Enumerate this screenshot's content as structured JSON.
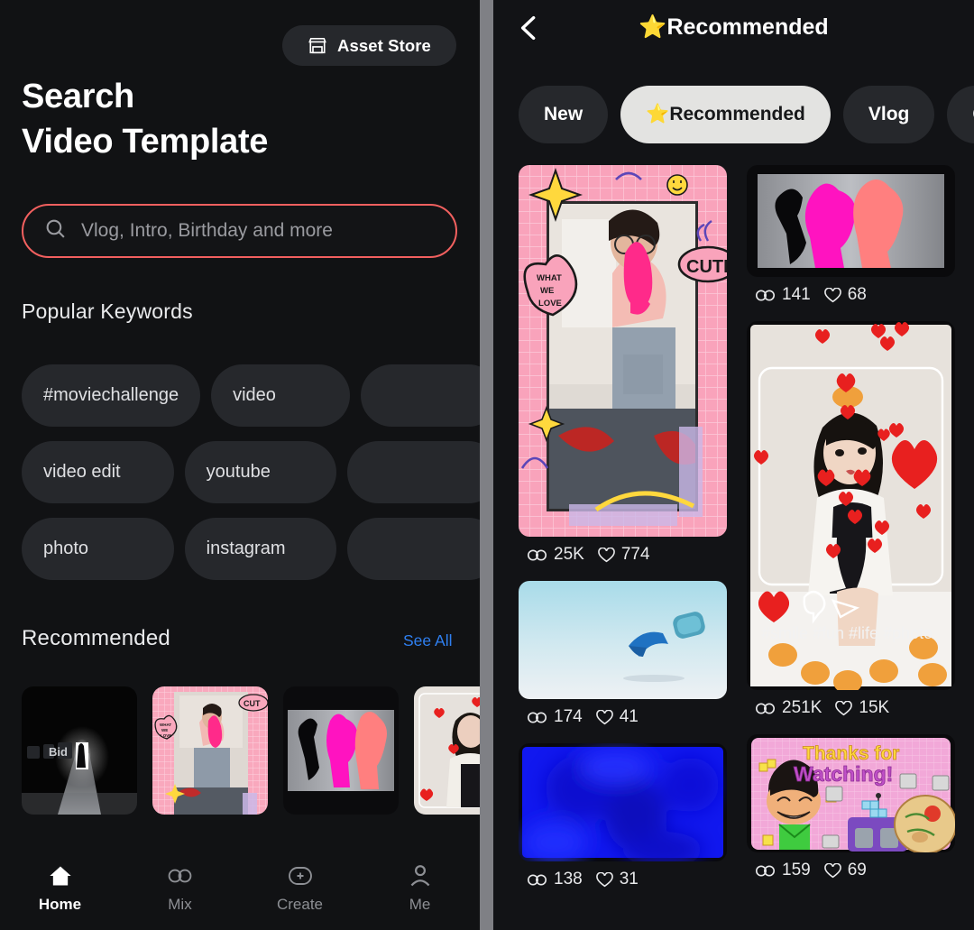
{
  "left": {
    "asset_store": {
      "label": "Asset Store",
      "icon": "store-icon"
    },
    "title_line1": "Search",
    "title_line2": "Video Template",
    "search": {
      "placeholder": "Vlog, Intro, Birthday and more",
      "icon": "search-icon",
      "border_color": "#f2605f"
    },
    "keywords_heading": "Popular Keywords",
    "keywords": [
      [
        "#moviechallenge",
        "video",
        ""
      ],
      [
        "video edit",
        "youtube",
        ""
      ],
      [
        "photo",
        "instagram",
        ""
      ]
    ],
    "recommended_heading": "Recommended",
    "see_all": "See All",
    "recommended_thumbs": [
      {
        "name": "dark-hallway-template"
      },
      {
        "name": "pink-scrapbook-template"
      },
      {
        "name": "neon-silhouette-template"
      },
      {
        "name": "hearts-girl-template"
      }
    ],
    "nav": [
      {
        "label": "Home",
        "icon": "home-icon",
        "active": true
      },
      {
        "label": "Mix",
        "icon": "mix-icon",
        "active": false
      },
      {
        "label": "Create",
        "icon": "plus-circle-icon",
        "active": false
      },
      {
        "label": "Me",
        "icon": "person-icon",
        "active": false
      }
    ]
  },
  "right": {
    "back_icon": "chevron-left-icon",
    "title": "⭐Recommended",
    "tabs": [
      {
        "label": "New",
        "active": false
      },
      {
        "label": "⭐Recommended",
        "active": true
      },
      {
        "label": "Vlog",
        "active": false
      },
      {
        "label": "G",
        "active": false
      }
    ],
    "cards": {
      "left_col": [
        {
          "name": "pink-scrapbook-card",
          "plays": "25K",
          "likes": "774"
        },
        {
          "name": "blue-sky-card",
          "plays": "174",
          "likes": "41"
        },
        {
          "name": "blue-abstract-card",
          "plays": "138",
          "likes": "31"
        }
      ],
      "right_col": [
        {
          "name": "neon-silhouette-card",
          "plays": "141",
          "likes": "68"
        },
        {
          "name": "hearts-girl-card",
          "plays": "251K",
          "likes": "15K",
          "hashtags": "#smile #fun #life #photo"
        },
        {
          "name": "thanks-for-watching-card",
          "plays": "159",
          "likes": "69",
          "title_line1": "Thanks for",
          "title_line2": "Watching!"
        }
      ]
    }
  },
  "colors": {
    "bg": "#111214",
    "panel": "#121316",
    "chip": "#26282c",
    "accent_search": "#f2605f",
    "link": "#2f7ff0",
    "divider": "#7f8085"
  }
}
